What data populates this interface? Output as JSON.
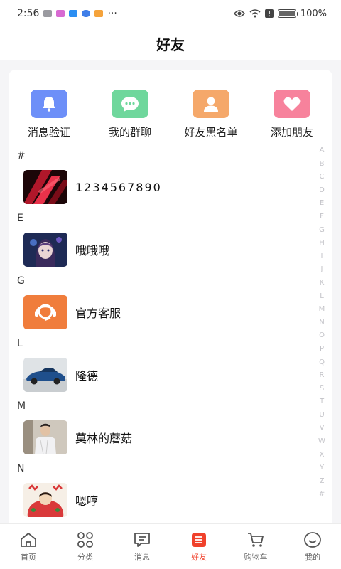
{
  "status_bar": {
    "time": "2:56",
    "more": "···",
    "battery": "100%",
    "battery_level": 1.0
  },
  "header": {
    "title": "好友"
  },
  "quick_actions": [
    {
      "label": "消息验证",
      "icon": "bell-icon",
      "color": "#6d8ff8"
    },
    {
      "label": "我的群聊",
      "icon": "chat-bubble-icon",
      "color": "#6fd79c"
    },
    {
      "label": "好友黑名单",
      "icon": "person-icon",
      "color": "#f5a86a"
    },
    {
      "label": "添加朋友",
      "icon": "heart-icon",
      "color": "#f7829c"
    }
  ],
  "sections": [
    {
      "letter": "#",
      "contacts": [
        {
          "name": "1234567890",
          "avatar": "red-abstract-avatar"
        }
      ]
    },
    {
      "letter": "E",
      "contacts": [
        {
          "name": "哦哦哦",
          "avatar": "anime-girl-avatar"
        }
      ]
    },
    {
      "letter": "G",
      "contacts": [
        {
          "name": "官方客服",
          "avatar": "customer-service-avatar"
        }
      ]
    },
    {
      "letter": "L",
      "contacts": [
        {
          "name": "隆德",
          "avatar": "blue-car-avatar"
        }
      ]
    },
    {
      "letter": "M",
      "contacts": [
        {
          "name": "莫林的蘑菇",
          "avatar": "person-photo-avatar"
        }
      ]
    },
    {
      "letter": "N",
      "contacts": [
        {
          "name": "嗯哼",
          "avatar": "cartoon-avatar"
        }
      ]
    }
  ],
  "alpha_index": [
    "A",
    "B",
    "C",
    "D",
    "E",
    "F",
    "G",
    "H",
    "I",
    "J",
    "K",
    "L",
    "M",
    "N",
    "O",
    "P",
    "Q",
    "R",
    "S",
    "T",
    "U",
    "V",
    "W",
    "X",
    "Y",
    "Z",
    "#"
  ],
  "tabs": [
    {
      "label": "首页",
      "icon": "home-icon",
      "active": false
    },
    {
      "label": "分类",
      "icon": "category-icon",
      "active": false
    },
    {
      "label": "消息",
      "icon": "message-icon",
      "active": false
    },
    {
      "label": "好友",
      "icon": "friends-list-icon",
      "active": true
    },
    {
      "label": "购物车",
      "icon": "cart-icon",
      "active": false
    },
    {
      "label": "我的",
      "icon": "profile-smile-icon",
      "active": false
    }
  ],
  "colors": {
    "accent": "#f0412b",
    "index_text": "#c3c3c8"
  }
}
